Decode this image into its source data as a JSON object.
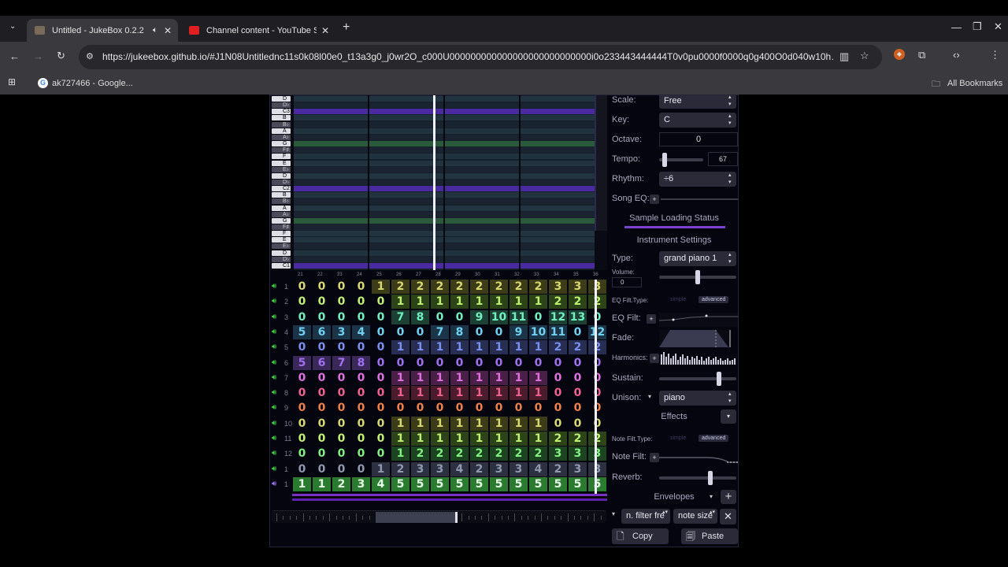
{
  "browser": {
    "tabs": [
      {
        "title": "Untitled - JukeBox 0.2.2",
        "fav_color": "#7a6a5a",
        "active": true
      },
      {
        "title": "Channel content - YouTube Stu",
        "fav_color": "#e02020",
        "active": false
      }
    ],
    "url": "https://jukeebox.github.io/#J1N08Untitlednc11s0k08l00e0_t13a3g0_j0wr2O_c000U000000000000000000000000000i0o233443444444T0v0pu0000f0000q0g400O0d040w10h…",
    "bookmarks": [
      {
        "label": "ak727466 - Google..."
      }
    ],
    "all_bookmarks": "All Bookmarks"
  },
  "app": {
    "piano_keys": [
      {
        "n": "D",
        "t": "w"
      },
      {
        "n": "D♭",
        "t": "b"
      },
      {
        "n": "C3",
        "t": "w"
      },
      {
        "n": "B",
        "t": "w"
      },
      {
        "n": "B♭",
        "t": "b"
      },
      {
        "n": "A",
        "t": "w"
      },
      {
        "n": "A♭",
        "t": "b"
      },
      {
        "n": "G",
        "t": "w"
      },
      {
        "n": "F♯",
        "t": "b"
      },
      {
        "n": "F",
        "t": "w"
      },
      {
        "n": "E",
        "t": "w"
      },
      {
        "n": "E♭",
        "t": "b"
      },
      {
        "n": "D",
        "t": "w"
      },
      {
        "n": "D♭",
        "t": "b"
      },
      {
        "n": "C2",
        "t": "w"
      },
      {
        "n": "B",
        "t": "w"
      },
      {
        "n": "B♭",
        "t": "b"
      },
      {
        "n": "A",
        "t": "w"
      },
      {
        "n": "A♭",
        "t": "b"
      },
      {
        "n": "G",
        "t": "w"
      },
      {
        "n": "F♯",
        "t": "b"
      },
      {
        "n": "F",
        "t": "w"
      },
      {
        "n": "E",
        "t": "w"
      },
      {
        "n": "E♭",
        "t": "b"
      },
      {
        "n": "D",
        "t": "w"
      },
      {
        "n": "D♭",
        "t": "b"
      },
      {
        "n": "C1",
        "t": "w"
      }
    ],
    "pattern_numbers": [
      "21",
      "22",
      "23",
      "24",
      "25",
      "26",
      "27",
      "28",
      "29",
      "30",
      "31",
      "32",
      "33",
      "34",
      "35",
      "36"
    ],
    "tracks": [
      {
        "num": "1",
        "color": "#d8d870",
        "bg": "#3c3c18",
        "values": [
          "0",
          "0",
          "0",
          "0",
          "1",
          "2",
          "2",
          "2",
          "2",
          "2",
          "2",
          "2",
          "2",
          "3",
          "3",
          "3"
        ],
        "hl_from": 4
      },
      {
        "num": "2",
        "color": "#c0f070",
        "bg": "#2c4418",
        "values": [
          "0",
          "0",
          "0",
          "0",
          "0",
          "1",
          "1",
          "1",
          "1",
          "1",
          "1",
          "1",
          "1",
          "2",
          "2",
          "2"
        ],
        "hl_from": 5
      },
      {
        "num": "3",
        "color": "#70f0c0",
        "bg": "#1c4034",
        "values": [
          "0",
          "0",
          "0",
          "0",
          "0",
          "7",
          "8",
          "0",
          "0",
          "9",
          "10",
          "11",
          "0",
          "12",
          "13",
          "0"
        ],
        "hl_from": 5
      },
      {
        "num": "4",
        "color": "#70d0f0",
        "bg": "#1c3448",
        "values": [
          "5",
          "6",
          "3",
          "4",
          "0",
          "0",
          "0",
          "7",
          "8",
          "0",
          "0",
          "9",
          "10",
          "11",
          "0",
          "12"
        ],
        "hl_from": 0
      },
      {
        "num": "5",
        "color": "#7890f0",
        "bg": "#282e52",
        "values": [
          "0",
          "0",
          "0",
          "0",
          "0",
          "1",
          "1",
          "1",
          "1",
          "1",
          "1",
          "1",
          "1",
          "2",
          "2",
          "2"
        ],
        "hl_from": 5
      },
      {
        "num": "6",
        "color": "#a070f0",
        "bg": "#3a2858",
        "values": [
          "5",
          "6",
          "7",
          "8",
          "0",
          "0",
          "0",
          "0",
          "0",
          "0",
          "0",
          "0",
          "0",
          "0",
          "0",
          "0"
        ],
        "hl_from": 0
      },
      {
        "num": "7",
        "color": "#e070e0",
        "bg": "#4a2048",
        "values": [
          "0",
          "0",
          "0",
          "0",
          "0",
          "1",
          "1",
          "1",
          "1",
          "1",
          "1",
          "1",
          "1",
          "0",
          "0",
          "0"
        ],
        "hl_from": 5
      },
      {
        "num": "8",
        "color": "#f06090",
        "bg": "#4a1c2c",
        "values": [
          "0",
          "0",
          "0",
          "0",
          "0",
          "1",
          "1",
          "1",
          "1",
          "1",
          "1",
          "1",
          "1",
          "0",
          "0",
          "0"
        ],
        "hl_from": 5
      },
      {
        "num": "9",
        "color": "#f08048",
        "bg": "#4a2814",
        "values": [
          "0",
          "0",
          "0",
          "0",
          "0",
          "0",
          "0",
          "0",
          "0",
          "0",
          "0",
          "0",
          "0",
          "0",
          "0",
          "0"
        ],
        "hl_from": 99
      },
      {
        "num": "10",
        "color": "#d8d870",
        "bg": "#3c3c18",
        "values": [
          "0",
          "0",
          "0",
          "0",
          "0",
          "1",
          "1",
          "1",
          "1",
          "1",
          "1",
          "1",
          "1",
          "0",
          "0",
          "0"
        ],
        "hl_from": 5
      },
      {
        "num": "11",
        "color": "#c0f070",
        "bg": "#2c4418",
        "values": [
          "0",
          "0",
          "0",
          "0",
          "0",
          "1",
          "1",
          "1",
          "1",
          "1",
          "1",
          "1",
          "1",
          "2",
          "2",
          "2"
        ],
        "hl_from": 5
      },
      {
        "num": "12",
        "color": "#80f080",
        "bg": "#1c4420",
        "values": [
          "0",
          "0",
          "0",
          "0",
          "0",
          "1",
          "2",
          "2",
          "2",
          "2",
          "2",
          "2",
          "2",
          "3",
          "3",
          "3"
        ],
        "hl_from": 5
      },
      {
        "num": "1",
        "color": "#9098b0",
        "bg": "#2c3040",
        "values": [
          "0",
          "0",
          "0",
          "0",
          "1",
          "2",
          "3",
          "3",
          "4",
          "2",
          "3",
          "3",
          "4",
          "2",
          "3",
          "3"
        ],
        "hl_from": 4
      },
      {
        "num": "1",
        "color": "#e8ffe8",
        "bg": "#2a7a30",
        "values": [
          "1",
          "1",
          "2",
          "3",
          "4",
          "5",
          "5",
          "5",
          "5",
          "5",
          "5",
          "5",
          "5",
          "5",
          "5",
          "5"
        ],
        "hl_from": 0
      }
    ],
    "sidebar": {
      "scale_label": "Scale:",
      "scale_value": "Free",
      "key_label": "Key:",
      "key_value": "C",
      "octave_label": "Octave:",
      "octave_value": "0",
      "tempo_label": "Tempo:",
      "tempo_value": "67",
      "rhythm_label": "Rhythm:",
      "rhythm_value": "÷6",
      "song_eq_label": "Song EQ:",
      "sample_status": "Sample Loading Status",
      "instrument_settings": "Instrument Settings",
      "type_label": "Type:",
      "type_value": "grand piano 1",
      "volume_label": "Volume:",
      "volume_value": "0",
      "eq_filt_type_label": "EQ Filt.Type:",
      "simple_label": "simple",
      "advanced_label": "advanced",
      "eq_filt_label": "EQ Filt:",
      "fade_label": "Fade:",
      "harmonics_label": "Harmonics:",
      "sustain_label": "Sustain:",
      "unison_label": "Unison:",
      "unison_value": "piano",
      "effects_label": "Effects",
      "note_filt_type_label": "Note Filt.Type:",
      "note_filt_label": "Note Filt:",
      "reverb_label": "Reverb:",
      "envelopes_label": "Envelopes",
      "env_target_value": "n. filter fre",
      "env_type_value": "note size",
      "copy_label": "Copy",
      "paste_label": "Paste",
      "tempo_level": 0.12,
      "volume_level": 0.5,
      "sustain_level": 0.78,
      "reverb_level": 0.66
    }
  }
}
